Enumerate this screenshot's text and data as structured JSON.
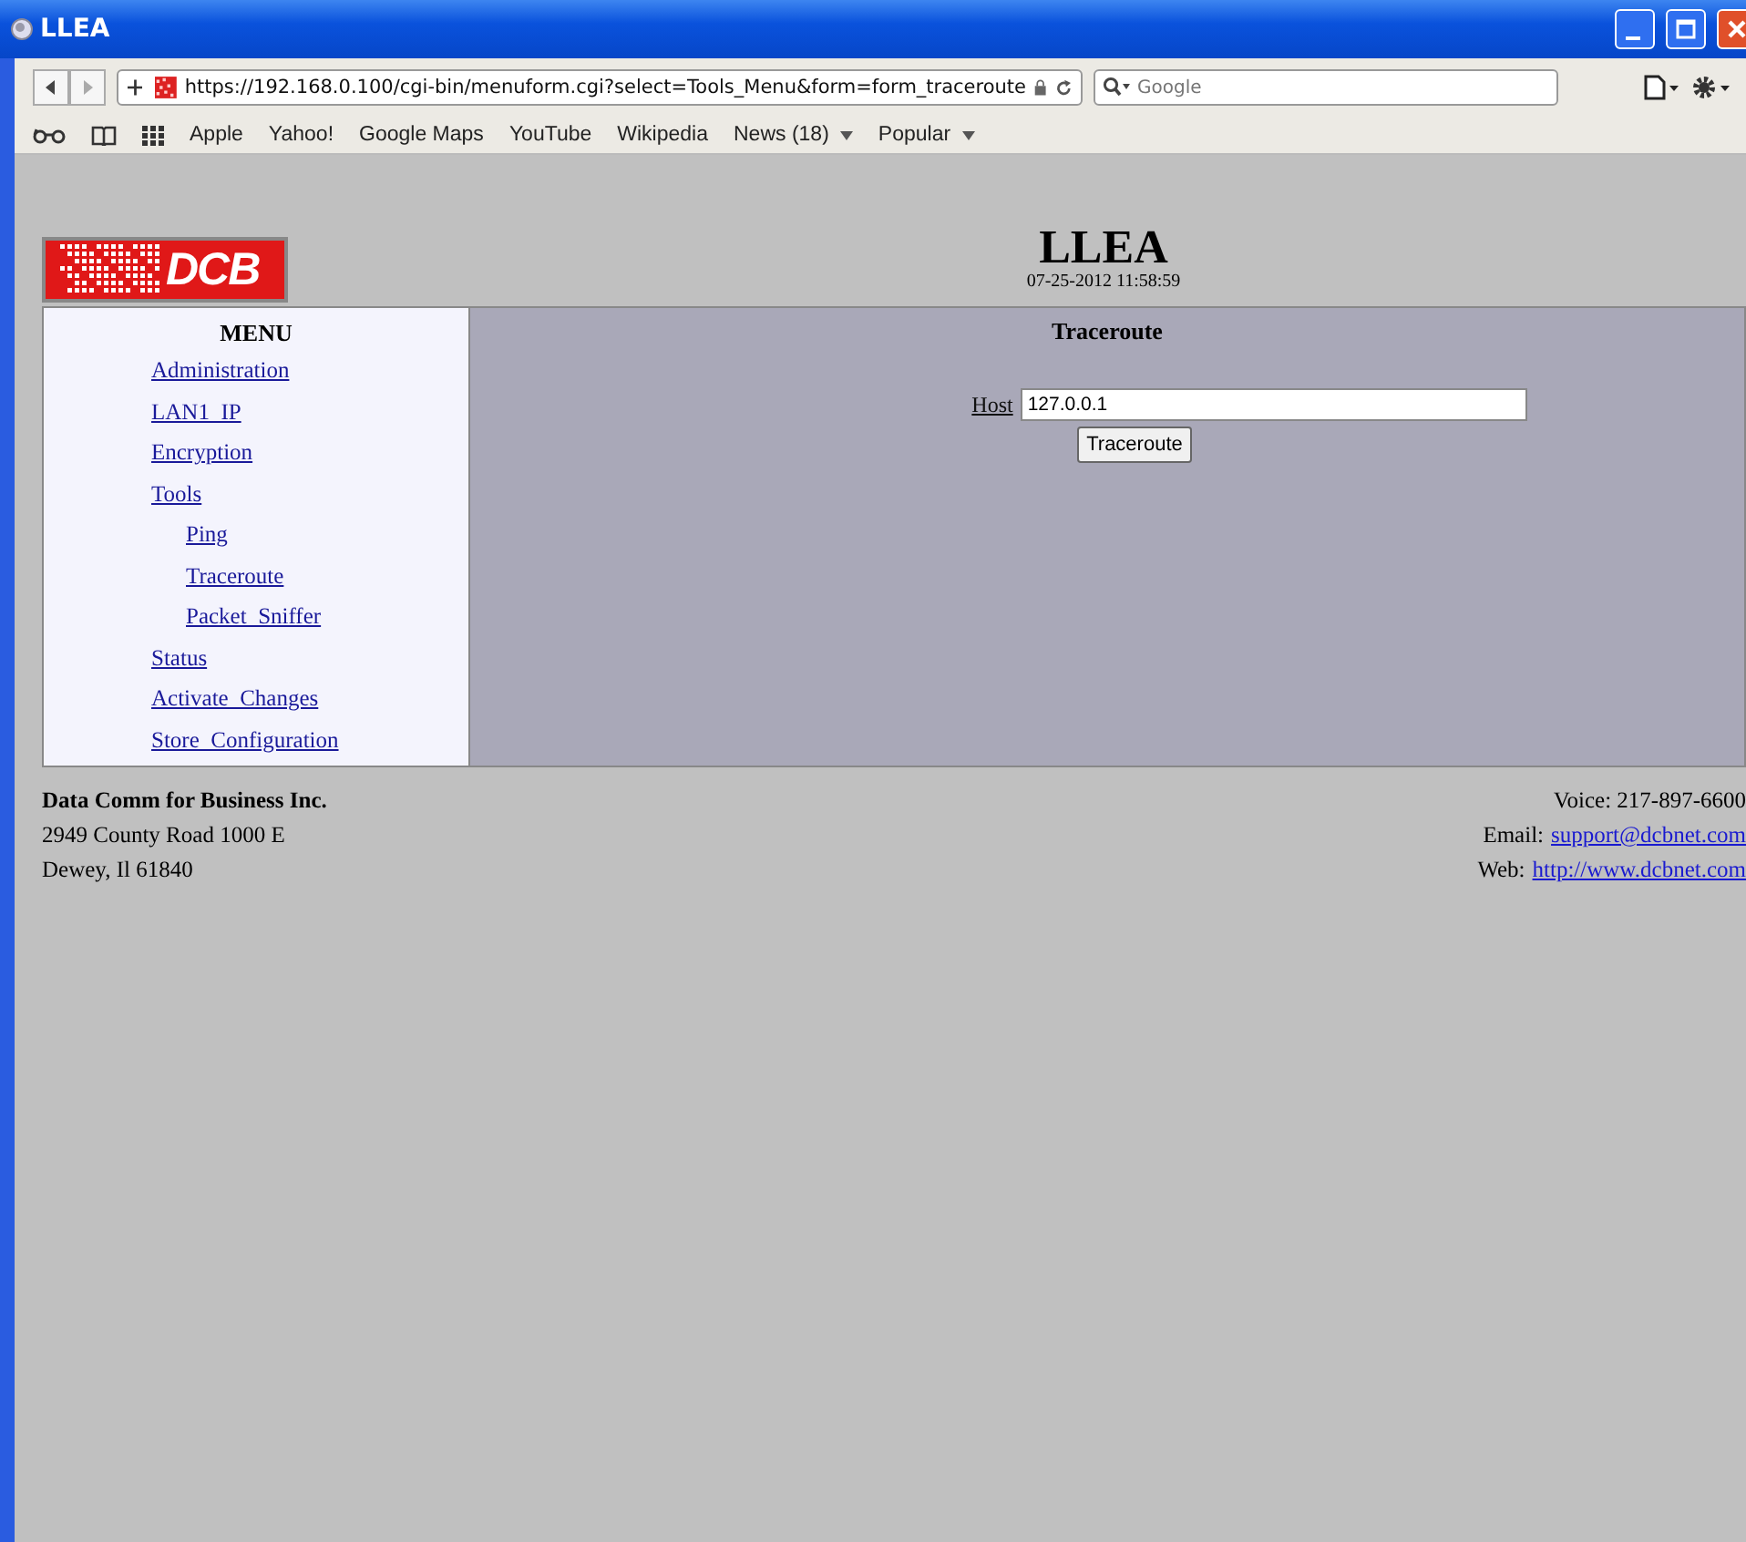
{
  "window": {
    "title": "LLEA"
  },
  "browser": {
    "url": "https://192.168.0.100/cgi-bin/menuform.cgi?select=Tools_Menu&form=form_traceroute",
    "search": {
      "placeholder": "Google"
    },
    "bookmarks": [
      {
        "label": "Apple",
        "kind": "link"
      },
      {
        "label": "Yahoo!",
        "kind": "link"
      },
      {
        "label": "Google Maps",
        "kind": "link"
      },
      {
        "label": "YouTube",
        "kind": "link"
      },
      {
        "label": "Wikipedia",
        "kind": "link"
      },
      {
        "label": "News (18)",
        "kind": "menu"
      },
      {
        "label": "Popular",
        "kind": "menu"
      }
    ]
  },
  "header": {
    "logo": "DCB",
    "title": "LLEA",
    "datetime": "07-25-2012 11:58:59"
  },
  "menu": {
    "title": "MENU",
    "items": [
      {
        "label": "Administration"
      },
      {
        "label": "LAN1_IP"
      },
      {
        "label": "Encryption"
      },
      {
        "label": "Tools",
        "children": [
          {
            "label": "Ping"
          },
          {
            "label": "Traceroute"
          },
          {
            "label": "Packet_Sniffer"
          }
        ]
      },
      {
        "label": "Status"
      },
      {
        "label": "Activate_Changes"
      },
      {
        "label": "Store_Configuration"
      }
    ]
  },
  "panel": {
    "title": "Traceroute",
    "host_label": "Host",
    "host_value": "127.0.0.1",
    "button": "Traceroute"
  },
  "footer": {
    "left": [
      {
        "text": "Data Comm for Business Inc.",
        "bold": true
      },
      {
        "text": "2949 County Road 1000 E",
        "bold": false
      },
      {
        "text": "Dewey, Il 61840",
        "bold": false
      }
    ],
    "right": [
      {
        "label": "Voice: 217-897-6600"
      },
      {
        "label": "Email:",
        "link": "support@dcbnet.com"
      },
      {
        "label": "Web:",
        "link": "http://www.dcbnet.com"
      }
    ]
  }
}
